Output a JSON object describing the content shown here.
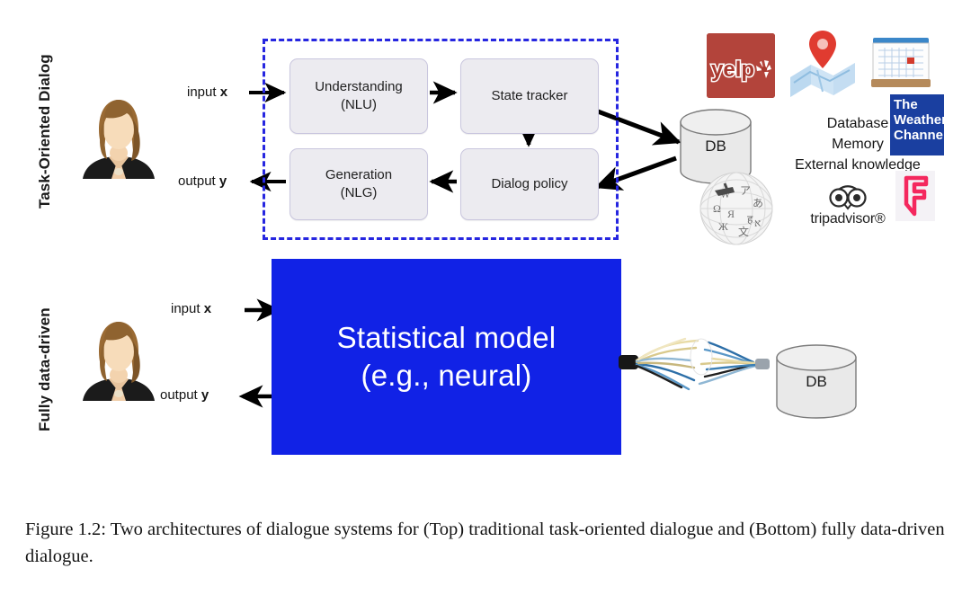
{
  "figure": {
    "caption": "Figure 1.2: Two architectures of dialogue systems for (Top) traditional task-oriented dialogue and (Bottom) fully data-driven dialogue."
  },
  "sections": {
    "top": {
      "side_label": "Task-Oriented Dialog",
      "input_label": "input ",
      "input_var": "x",
      "output_label": "output ",
      "output_var": "y",
      "boxes": [
        {
          "id": "nlu",
          "line1": "Understanding",
          "line2": "(NLU)"
        },
        {
          "id": "state",
          "line1": "State tracker",
          "line2": ""
        },
        {
          "id": "nlg",
          "line1": "Generation",
          "line2": "(NLG)"
        },
        {
          "id": "policy",
          "line1": "Dialog policy",
          "line2": ""
        }
      ],
      "db_label": "DB",
      "knowledge_lines": [
        "Database",
        "Memory",
        "External knowledge"
      ],
      "logos": [
        {
          "id": "yelp",
          "name": "yelp-logo",
          "text": "yelp"
        },
        {
          "id": "maps",
          "name": "maps-logo",
          "text": ""
        },
        {
          "id": "calendar",
          "name": "calendar-logo",
          "text": ""
        },
        {
          "id": "weather",
          "name": "weather-channel-logo",
          "text": "The Weather Channel"
        },
        {
          "id": "wikipedia",
          "name": "wikipedia-logo",
          "text": ""
        },
        {
          "id": "tripadvisor",
          "name": "tripadvisor-logo",
          "text": "tripadvisor®"
        },
        {
          "id": "foursquare",
          "name": "foursquare-logo",
          "text": ""
        }
      ]
    },
    "bottom": {
      "side_label": "Fully data-driven",
      "input_label": "input ",
      "input_var": "x",
      "output_label": "output ",
      "output_var": "y",
      "model_line1": "Statistical model",
      "model_line2": "(e.g., neural)",
      "db_label": "DB"
    }
  },
  "weather_logo_lines": [
    "The",
    "Weather",
    "Channel"
  ],
  "colors": {
    "model_blue": "#1122e6",
    "dashed_border": "#2626e0",
    "box_fill": "#ecebf0",
    "box_border": "#c9c6de",
    "yelp_red": "#b3443b",
    "weather_blue": "#1a3fa0",
    "foursquare_pink": "#f94877",
    "arrow_black": "#000000"
  }
}
